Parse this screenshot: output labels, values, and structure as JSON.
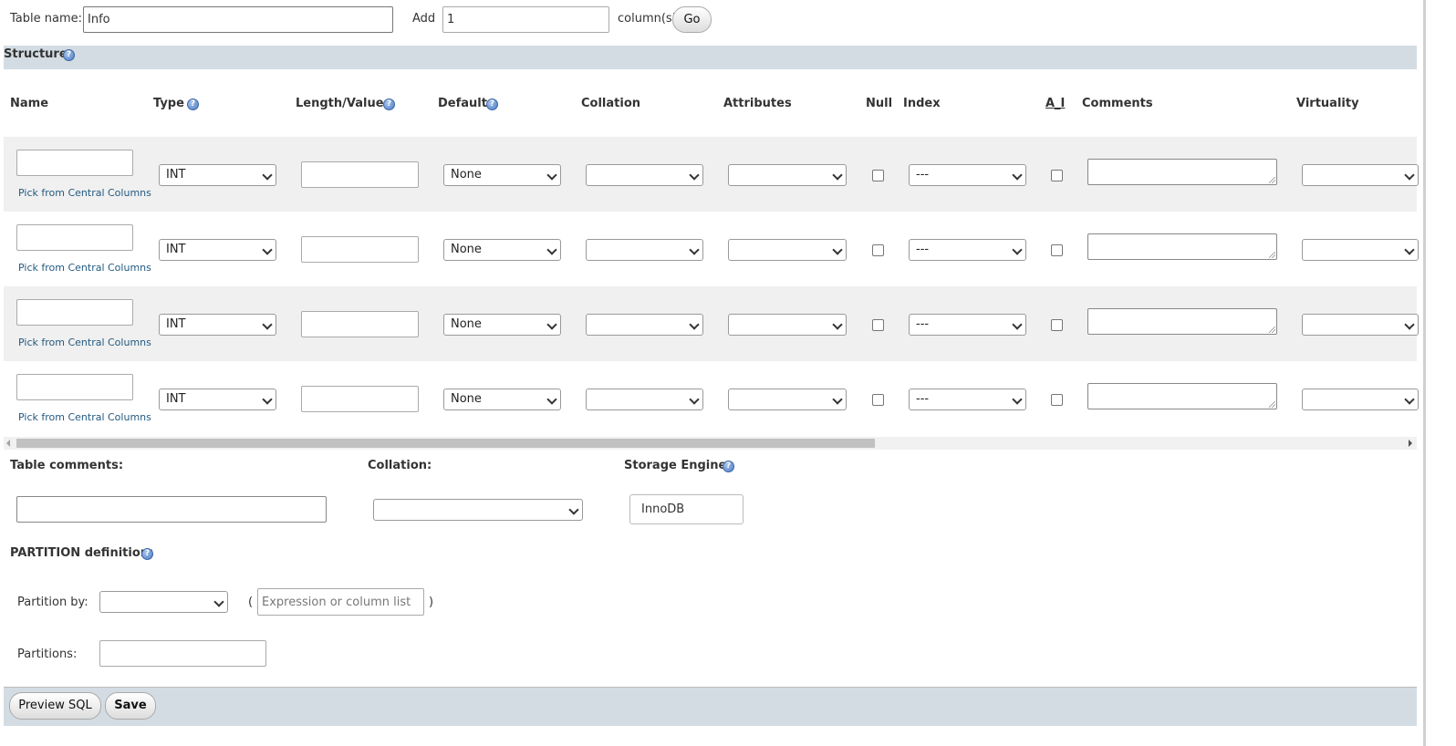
{
  "top": {
    "table_name_label": "Table name:",
    "table_name_value": "Info",
    "add_label": "Add",
    "add_value": "1",
    "columns_label": "column(s)",
    "go_label": "Go"
  },
  "structure": {
    "title": "Structure",
    "headers": {
      "name": "Name",
      "type": "Type",
      "length": "Length/Values",
      "default": "Default",
      "collation": "Collation",
      "attributes": "Attributes",
      "null": "Null",
      "index": "Index",
      "ai": "A_I",
      "comments": "Comments",
      "virtuality": "Virtuality"
    },
    "rows": [
      {
        "name": "",
        "pick_label": "Pick from Central Columns",
        "type": "INT",
        "length": "",
        "default": "None",
        "collation": "",
        "attributes": "",
        "index": "---",
        "virtuality": ""
      },
      {
        "name": "",
        "pick_label": "Pick from Central Columns",
        "type": "INT",
        "length": "",
        "default": "None",
        "collation": "",
        "attributes": "",
        "index": "---",
        "virtuality": ""
      },
      {
        "name": "",
        "pick_label": "Pick from Central Columns",
        "type": "INT",
        "length": "",
        "default": "None",
        "collation": "",
        "attributes": "",
        "index": "---",
        "virtuality": ""
      },
      {
        "name": "",
        "pick_label": "Pick from Central Columns",
        "type": "INT",
        "length": "",
        "default": "None",
        "collation": "",
        "attributes": "",
        "index": "---",
        "virtuality": ""
      }
    ]
  },
  "table_options": {
    "comments_label": "Table comments:",
    "collation_label": "Collation:",
    "storage_label": "Storage Engine:",
    "storage_value": "InnoDB"
  },
  "partition": {
    "title": "PARTITION definition:",
    "partition_by_label": "Partition by:",
    "open_paren": "(",
    "close_paren": ")",
    "expression_placeholder": "Expression or column list",
    "partitions_label": "Partitions:"
  },
  "footer": {
    "preview_label": "Preview SQL",
    "save_label": "Save"
  },
  "icons": {
    "help": "help-icon"
  }
}
